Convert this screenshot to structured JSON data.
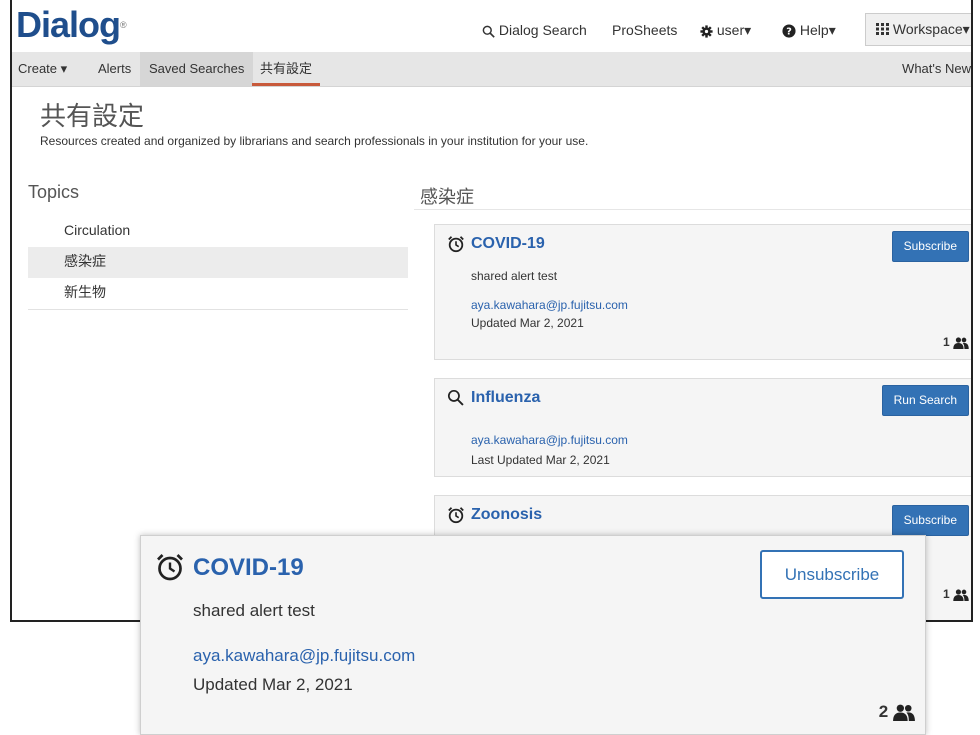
{
  "app": {
    "logo": "Dialog",
    "logo_mark": "®"
  },
  "topnav": {
    "search": "Dialog Search",
    "prosheets": "ProSheets",
    "user": "user",
    "help": "Help",
    "workspace": "Workspace"
  },
  "subnav": {
    "create": "Create",
    "alerts": "Alerts",
    "saved_searches": "Saved Searches",
    "shared_settings": "共有設定",
    "whats_new": "What's New"
  },
  "page": {
    "title": "共有設定",
    "description": "Resources created and organized by librarians and search professionals in your institution for your use."
  },
  "topics": {
    "heading": "Topics",
    "items": [
      {
        "label": "Circulation"
      },
      {
        "label": "感染症"
      },
      {
        "label": "新生物"
      }
    ],
    "active_index": 1
  },
  "section": {
    "heading": "感染症"
  },
  "cards": [
    {
      "icon": "alarm-clock-icon",
      "title": "COVID-19",
      "description": "shared alert test",
      "email": "aya.kawahara@jp.fujitsu.com",
      "updated": "Updated Mar 2, 2021",
      "button": "Subscribe",
      "count": "1"
    },
    {
      "icon": "search-icon",
      "title": "Influenza",
      "email": "aya.kawahara@jp.fujitsu.com",
      "updated": "Last Updated Mar 2, 2021",
      "button": "Run Search"
    },
    {
      "icon": "alarm-clock-icon",
      "title": "Zoonosis",
      "button": "Subscribe",
      "count": "1"
    }
  ],
  "zoomed_card": {
    "icon": "alarm-clock-icon",
    "title": "COVID-19",
    "description": "shared alert test",
    "email": "aya.kawahara@jp.fujitsu.com",
    "updated": "Updated Mar 2, 2021",
    "button": "Unsubscribe",
    "count": "2"
  },
  "colors": {
    "brand": "#1f4e8c",
    "link": "#2a62ad",
    "button": "#3372b5",
    "active_tab_underline": "#c85a3b"
  }
}
